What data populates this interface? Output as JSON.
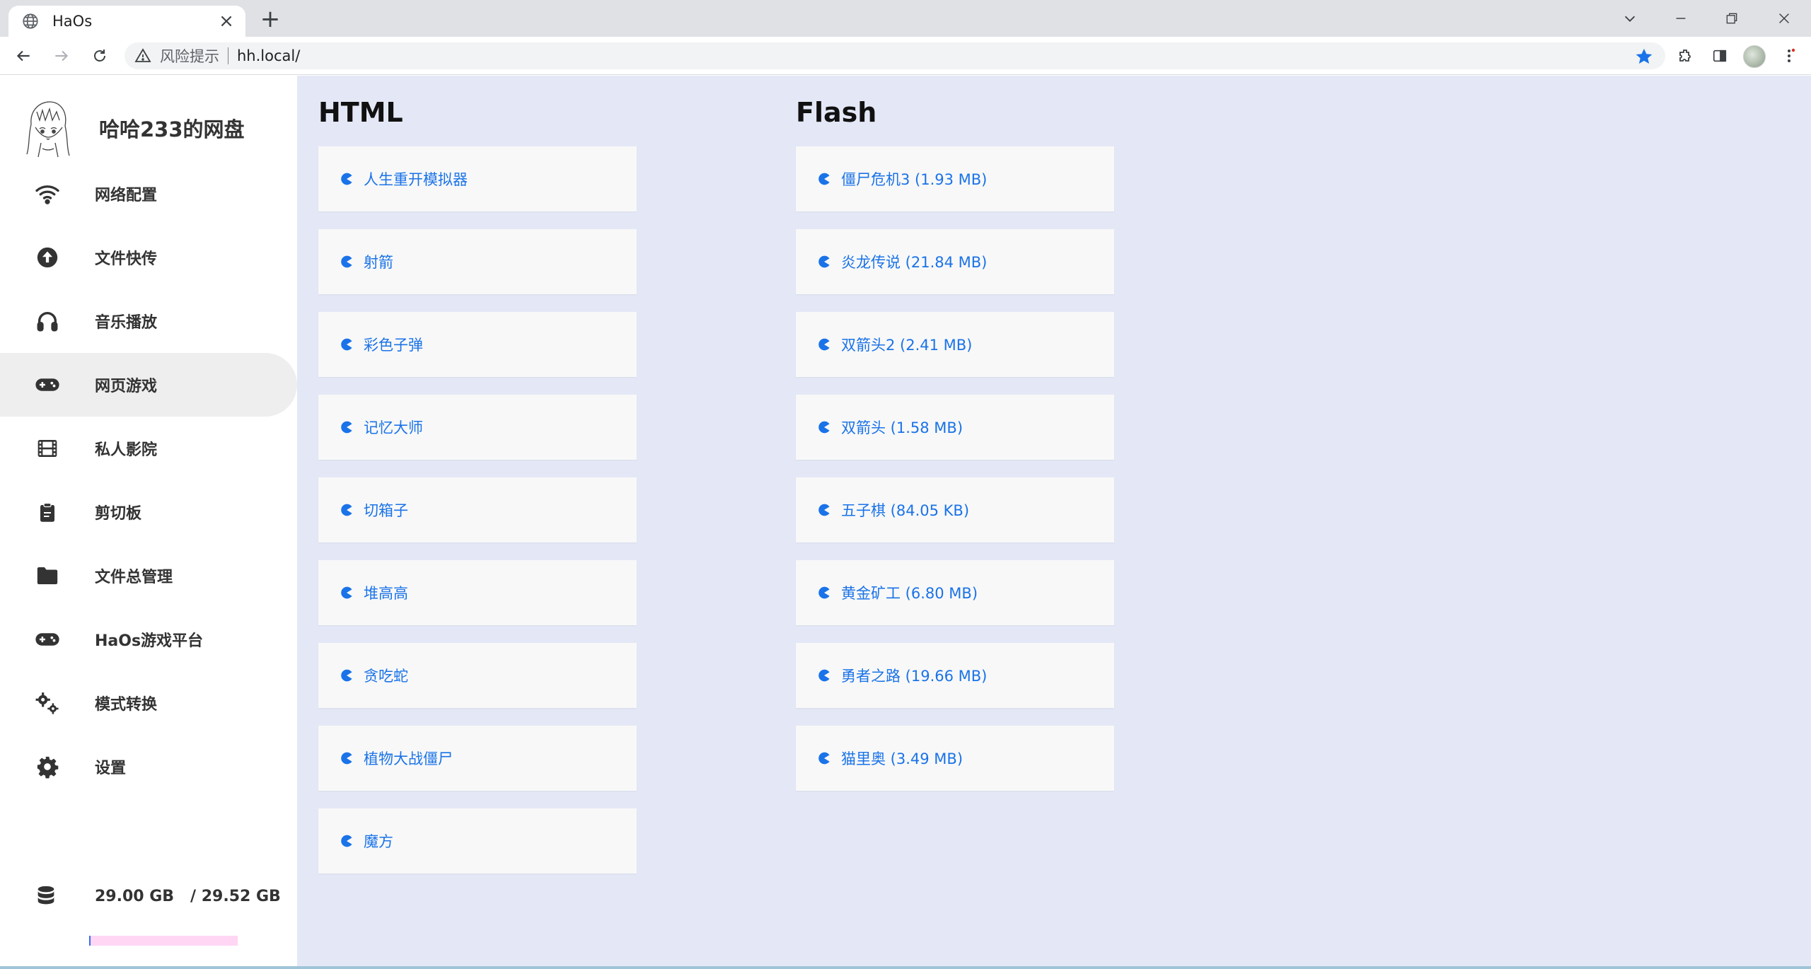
{
  "browser": {
    "tab_title": "HaOs",
    "risk_label": "风险提示",
    "url": "hh.local/"
  },
  "sidebar": {
    "site_name": "哈哈233的网盘",
    "items": [
      {
        "label": "网络配置",
        "icon": "wifi-icon"
      },
      {
        "label": "文件快传",
        "icon": "upload-icon"
      },
      {
        "label": "音乐播放",
        "icon": "headphones-icon"
      },
      {
        "label": "网页游戏",
        "icon": "gamepad-icon",
        "active": true
      },
      {
        "label": "私人影院",
        "icon": "film-icon"
      },
      {
        "label": "剪切板",
        "icon": "clipboard-icon"
      },
      {
        "label": "文件总管理",
        "icon": "folder-icon"
      },
      {
        "label": "HaOs游戏平台",
        "icon": "gamepad-icon"
      },
      {
        "label": "模式转换",
        "icon": "gears-icon"
      },
      {
        "label": "设置",
        "icon": "gear-icon"
      }
    ],
    "storage": {
      "used": "29.00 GB",
      "total": "/ 29.52 GB",
      "text": "29.00 GB   / 29.52 GB",
      "bar_color": "#ffd6f4"
    }
  },
  "main": {
    "html_section": {
      "title": "HTML",
      "games": [
        "人生重开模拟器",
        "射箭",
        "彩色子弹",
        "记忆大师",
        "切箱子",
        "堆高高",
        "贪吃蛇",
        "植物大战僵尸",
        "魔方"
      ]
    },
    "flash_section": {
      "title": "Flash",
      "games": [
        "僵尸危机3 (1.93 MB)",
        "炎龙传说 (21.84 MB)",
        "双箭头2 (2.41 MB)",
        "双箭头 (1.58 MB)",
        "五子棋 (84.05 KB)",
        "黄金矿工 (6.80 MB)",
        "勇者之路 (19.66 MB)",
        "猫里奥 (3.49 MB)"
      ]
    }
  },
  "colors": {
    "accent": "#1a73e8",
    "main_bg": "#e4e8f6",
    "card_bg": "#f8f8f8",
    "active_item_bg": "#eeeeee"
  }
}
